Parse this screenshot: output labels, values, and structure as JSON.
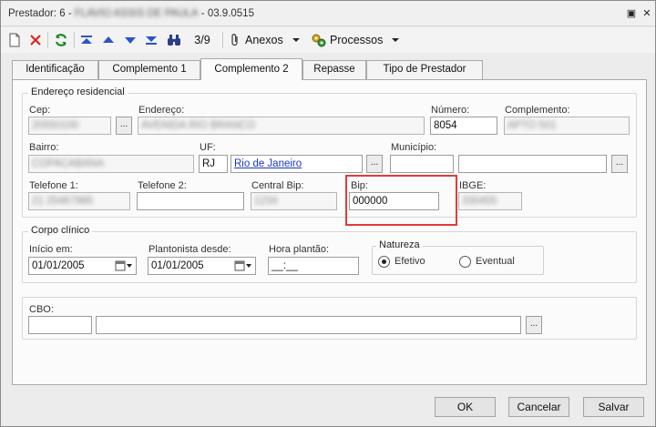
{
  "window": {
    "title_prefix": "Prestador: 6 - ",
    "title_name": "FLAVIO ASSIS DE PAULA",
    "title_suffix": " - 03.9.0515",
    "pin_glyph": "▣",
    "close_glyph": "✕"
  },
  "toolbar": {
    "record_counter": "3/9",
    "anexos_label": "Anexos",
    "processos_label": "Processos",
    "icons": [
      "new-document-icon",
      "delete-icon",
      "refresh-icon",
      "first-record-icon",
      "previous-record-icon",
      "next-record-icon",
      "last-record-icon",
      "binoculars-icon",
      "paperclip-icon",
      "processes-icon"
    ]
  },
  "tabs": [
    {
      "label": "Identificação"
    },
    {
      "label": "Complemento 1"
    },
    {
      "label": "Complemento 2",
      "active": true
    },
    {
      "label": "Repasse"
    },
    {
      "label": "Tipo de Prestador"
    }
  ],
  "endereco": {
    "group_label": "Endereço residencial",
    "cep_label": "Cep:",
    "cep_value": "20550100",
    "endereco_label": "Endereço:",
    "endereco_value": "AVENIDA RIO BRANCO",
    "numero_label": "Número:",
    "numero_value": "8054",
    "complemento_label": "Complemento:",
    "complemento_value": "APTO 501",
    "bairro_label": "Bairro:",
    "bairro_value": "COPACABANA",
    "uf_label": "UF:",
    "uf_value": "RJ",
    "uf_name": "Rio de Janeiro",
    "municipio_label": "Município:",
    "municipio_code": "",
    "municipio_name": "",
    "telefone1_label": "Telefone 1:",
    "telefone1_value": "21 25467985",
    "telefone2_label": "Telefone 2:",
    "telefone2_value": "",
    "central_bip_label": "Central Bip:",
    "central_bip_value": "1234",
    "bip_label": "Bip:",
    "bip_value": "000000",
    "ibge_label": "IBGE:",
    "ibge_value": "330455",
    "ellipsis": "..."
  },
  "corpo_clinico": {
    "group_label": "Corpo clínico",
    "inicio_label": "Início em:",
    "inicio_value": "01/01/2005",
    "plantonista_label": "Plantonista desde:",
    "plantonista_value": "01/01/2005",
    "hora_label": "Hora plantão:",
    "hora_value": "__:__",
    "natureza_label": "Natureza",
    "efetivo_label": "Efetivo",
    "eventual_label": "Eventual",
    "selected": "Efetivo"
  },
  "cbo": {
    "label": "CBO:",
    "code": "",
    "description": "",
    "ellipsis": "..."
  },
  "buttons": {
    "ok": "OK",
    "cancelar": "Cancelar",
    "salvar": "Salvar"
  },
  "colors": {
    "highlight": "#e03c3c",
    "link": "#1a35c9"
  }
}
